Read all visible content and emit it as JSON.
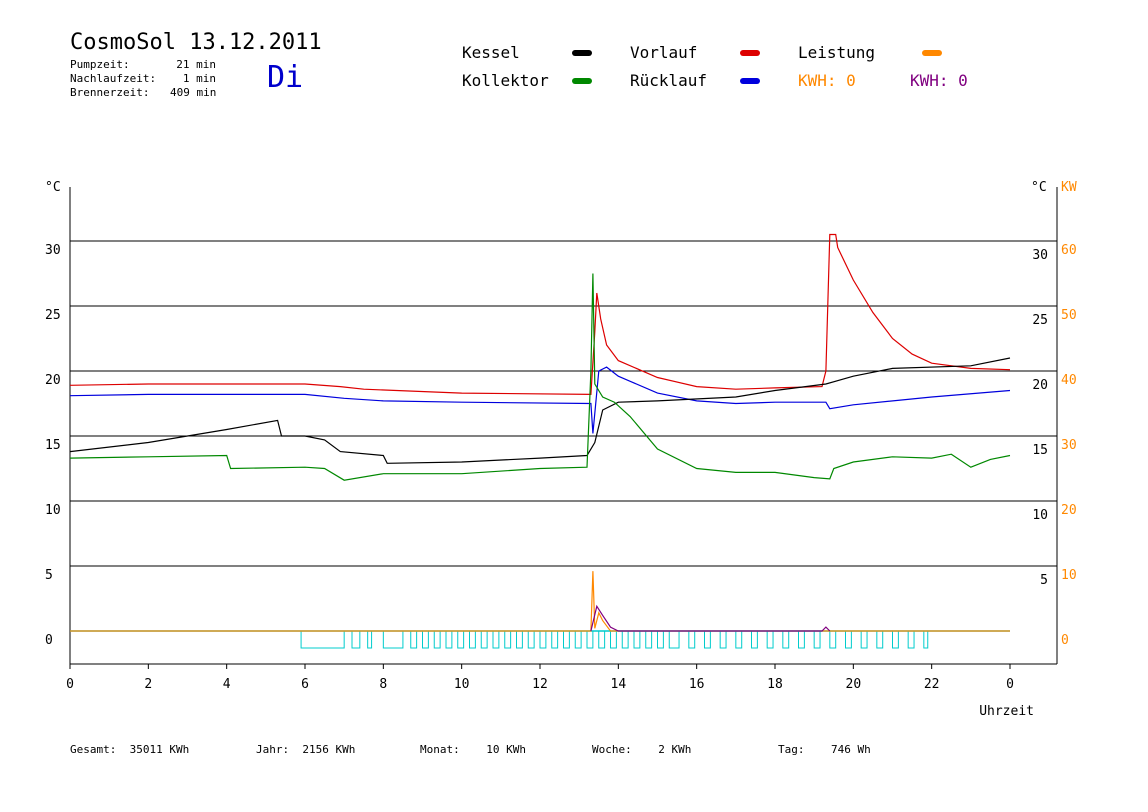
{
  "header": {
    "title": "CosmoSol 13.12.2011",
    "day": "Di",
    "stats": [
      {
        "label": "Pumpzeit:",
        "value": "21 min"
      },
      {
        "label": "Nachlaufzeit:",
        "value": "1 min"
      },
      {
        "label": "Brennerzeit:",
        "value": "409 min"
      }
    ]
  },
  "legend": {
    "kessel": {
      "label": "Kessel",
      "color": "#000000"
    },
    "vorlauf": {
      "label": "Vorlauf",
      "color": "#dd0000"
    },
    "leistung": {
      "label": "Leistung",
      "color": "#ff8800"
    },
    "kollektor": {
      "label": "Kollektor",
      "color": "#008800"
    },
    "ruecklauf": {
      "label": "Rücklauf",
      "color": "#0000dd"
    },
    "kwh1": {
      "label": "KWH: 0",
      "color": "#ff8800"
    },
    "kwh2": {
      "label": "KWH: 0",
      "color": "#800080"
    }
  },
  "footer": [
    {
      "label": "Gesamt:",
      "value": "35011 KWh"
    },
    {
      "label": "Jahr:",
      "value": "2156 KWh"
    },
    {
      "label": "Monat:",
      "value": "10 KWh"
    },
    {
      "label": "Woche:",
      "value": "2 KWh"
    },
    {
      "label": "Tag:",
      "value": "746 Wh"
    }
  ],
  "chart_data": {
    "type": "line",
    "xlabel": "Uhrzeit",
    "ylabel_left": "°C",
    "ylabel_right": "°C",
    "ylabel_right2": "KW",
    "xlim": [
      0,
      24
    ],
    "ylim": [
      -2.5,
      32
    ],
    "x_ticks": [
      "0",
      "2",
      "4",
      "6",
      "8",
      "10",
      "12",
      "14",
      "16",
      "18",
      "20",
      "22",
      "0"
    ],
    "y_ticks_left": [
      0,
      5,
      10,
      15,
      20,
      25,
      30
    ],
    "y_ticks_right": [
      5,
      10,
      15,
      20,
      25,
      30
    ],
    "y_ticks_kw": [
      0,
      10,
      20,
      30,
      40,
      50,
      60
    ],
    "grid": "horizontal",
    "series": [
      {
        "name": "Vorlauf",
        "color": "#dd0000",
        "points": [
          [
            0,
            18.9
          ],
          [
            2,
            19
          ],
          [
            6,
            19
          ],
          [
            6.9,
            18.8
          ],
          [
            7.5,
            18.6
          ],
          [
            10,
            18.3
          ],
          [
            13.3,
            18.2
          ],
          [
            13.4,
            23
          ],
          [
            13.45,
            26
          ],
          [
            13.55,
            24
          ],
          [
            13.7,
            22
          ],
          [
            14,
            20.8
          ],
          [
            15,
            19.5
          ],
          [
            16,
            18.8
          ],
          [
            17,
            18.6
          ],
          [
            18,
            18.7
          ],
          [
            19.2,
            18.8
          ],
          [
            19.3,
            20
          ],
          [
            19.4,
            30.5
          ],
          [
            19.55,
            30.5
          ],
          [
            19.6,
            29.5
          ],
          [
            20,
            27
          ],
          [
            20.5,
            24.5
          ],
          [
            21,
            22.5
          ],
          [
            21.5,
            21.3
          ],
          [
            22,
            20.6
          ],
          [
            23,
            20.2
          ],
          [
            24,
            20.1
          ]
        ]
      },
      {
        "name": "Rücklauf",
        "color": "#0000dd",
        "points": [
          [
            0,
            18.1
          ],
          [
            2,
            18.2
          ],
          [
            6,
            18.2
          ],
          [
            7,
            17.9
          ],
          [
            8,
            17.7
          ],
          [
            10,
            17.6
          ],
          [
            13.3,
            17.5
          ],
          [
            13.35,
            15.2
          ],
          [
            13.5,
            20
          ],
          [
            13.7,
            20.3
          ],
          [
            14,
            19.6
          ],
          [
            15,
            18.3
          ],
          [
            16,
            17.7
          ],
          [
            17,
            17.5
          ],
          [
            18,
            17.6
          ],
          [
            19.3,
            17.6
          ],
          [
            19.4,
            17.1
          ],
          [
            20,
            17.4
          ],
          [
            22,
            18
          ],
          [
            24,
            18.5
          ]
        ]
      },
      {
        "name": "Kessel",
        "color": "#000000",
        "points": [
          [
            0,
            13.8
          ],
          [
            2,
            14.5
          ],
          [
            4,
            15.5
          ],
          [
            5.3,
            16.2
          ],
          [
            5.4,
            15
          ],
          [
            6,
            15
          ],
          [
            6.5,
            14.7
          ],
          [
            6.9,
            13.8
          ],
          [
            8,
            13.5
          ],
          [
            8.1,
            12.9
          ],
          [
            10,
            13
          ],
          [
            12,
            13.3
          ],
          [
            13.2,
            13.5
          ],
          [
            13.4,
            14.5
          ],
          [
            13.6,
            17
          ],
          [
            14,
            17.6
          ],
          [
            15,
            17.7
          ],
          [
            17,
            18
          ],
          [
            18,
            18.5
          ],
          [
            19.3,
            19
          ],
          [
            20,
            19.6
          ],
          [
            21,
            20.2
          ],
          [
            23,
            20.4
          ],
          [
            24,
            21
          ]
        ]
      },
      {
        "name": "Kollektor",
        "color": "#008800",
        "points": [
          [
            0,
            13.3
          ],
          [
            2,
            13.4
          ],
          [
            4,
            13.5
          ],
          [
            4,
            13.5
          ],
          [
            4.1,
            12.5
          ],
          [
            6,
            12.6
          ],
          [
            6.5,
            12.5
          ],
          [
            7,
            11.6
          ],
          [
            8,
            12.1
          ],
          [
            10,
            12.1
          ],
          [
            12,
            12.5
          ],
          [
            13.2,
            12.6
          ],
          [
            13.3,
            20
          ],
          [
            13.35,
            27.5
          ],
          [
            13.4,
            19
          ],
          [
            13.6,
            18
          ],
          [
            13.9,
            17.6
          ],
          [
            14.3,
            16.5
          ],
          [
            15,
            14
          ],
          [
            16,
            12.5
          ],
          [
            17,
            12.2
          ],
          [
            18,
            12.2
          ],
          [
            19,
            11.8
          ],
          [
            19.4,
            11.7
          ],
          [
            19.5,
            12.5
          ],
          [
            20,
            13
          ],
          [
            21,
            13.4
          ],
          [
            22,
            13.3
          ],
          [
            22.5,
            13.6
          ],
          [
            23,
            12.6
          ],
          [
            23.5,
            13.2
          ],
          [
            24,
            13.5
          ]
        ]
      },
      {
        "name": "Leistung",
        "color": "#ff8800",
        "points": [
          [
            0,
            0
          ],
          [
            13.3,
            0
          ],
          [
            13.35,
            4.6
          ],
          [
            13.4,
            0.2
          ],
          [
            13.5,
            1.4
          ],
          [
            13.6,
            0.8
          ],
          [
            13.7,
            0.4
          ],
          [
            13.8,
            0
          ],
          [
            24,
            0
          ]
        ]
      },
      {
        "name": "KWH",
        "color": "#800080",
        "points": [
          [
            13.3,
            0
          ],
          [
            13.45,
            1.9
          ],
          [
            13.6,
            1.2
          ],
          [
            13.8,
            0.3
          ],
          [
            14,
            0
          ],
          [
            19.2,
            0
          ],
          [
            19.3,
            0.3
          ],
          [
            19.4,
            0
          ]
        ]
      }
    ],
    "pump_intervals": [
      [
        5.9,
        7
      ],
      [
        7.2,
        7.4
      ],
      [
        7.6,
        7.7
      ],
      [
        8,
        8.5
      ],
      [
        8.7,
        8.85
      ],
      [
        9,
        9.15
      ],
      [
        9.3,
        9.45
      ],
      [
        9.6,
        9.75
      ],
      [
        9.9,
        10.05
      ],
      [
        10.2,
        10.35
      ],
      [
        10.5,
        10.65
      ],
      [
        10.8,
        10.95
      ],
      [
        11.1,
        11.25
      ],
      [
        11.4,
        11.55
      ],
      [
        11.7,
        11.85
      ],
      [
        12,
        12.15
      ],
      [
        12.3,
        12.45
      ],
      [
        12.6,
        12.75
      ],
      [
        12.9,
        13.05
      ],
      [
        13.2,
        13.35
      ],
      [
        13.5,
        13.65
      ],
      [
        13.8,
        13.95
      ],
      [
        14.1,
        14.25
      ],
      [
        14.4,
        14.55
      ],
      [
        14.7,
        14.85
      ],
      [
        15,
        15.15
      ],
      [
        15.3,
        15.55
      ],
      [
        15.8,
        15.95
      ],
      [
        16.2,
        16.35
      ],
      [
        16.6,
        16.75
      ],
      [
        17,
        17.15
      ],
      [
        17.4,
        17.55
      ],
      [
        17.8,
        17.95
      ],
      [
        18.2,
        18.35
      ],
      [
        18.6,
        18.75
      ],
      [
        19,
        19.15
      ],
      [
        19.4,
        19.55
      ],
      [
        19.8,
        19.95
      ],
      [
        20.2,
        20.35
      ],
      [
        20.6,
        20.75
      ],
      [
        21,
        21.15
      ],
      [
        21.4,
        21.55
      ],
      [
        21.8,
        21.9
      ]
    ]
  }
}
